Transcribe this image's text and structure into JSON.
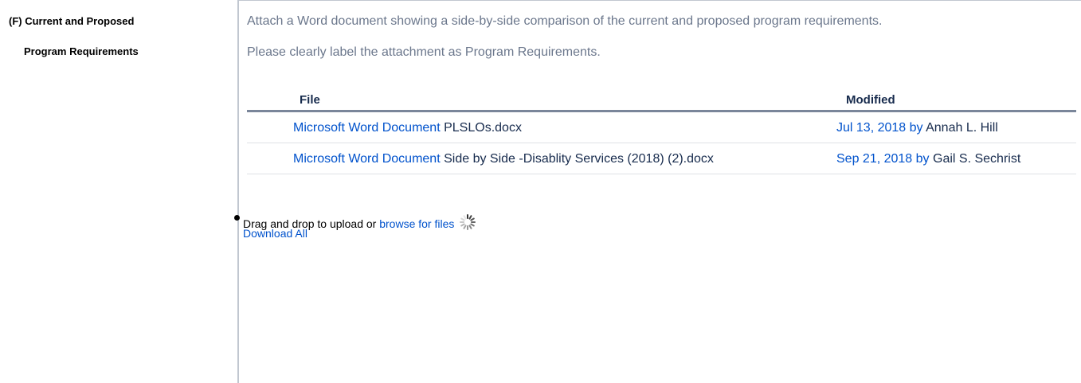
{
  "section": {
    "title_line1": "(F) Current and Proposed",
    "title_line2": "Program Requirements"
  },
  "instructions": {
    "line1": "Attach a Word document showing a side-by-side comparison of the current and proposed program requirements.",
    "line2": "Please clearly label the attachment as Program Requirements."
  },
  "table": {
    "headers": {
      "file": "File",
      "modified": "Modified"
    },
    "rows": [
      {
        "file_type": "Microsoft Word Document",
        "file_name": "PLSLOs.docx",
        "date": "Jul 13, 2018",
        "by": "by",
        "author": "Annah L. Hill"
      },
      {
        "file_type": "Microsoft Word Document",
        "file_name": "Side by Side -Disablity Services (2018) (2).docx",
        "date": "Sep 21, 2018",
        "by": "by",
        "author": "Gail S. Sechrist"
      }
    ]
  },
  "upload": {
    "prompt": "Drag and drop to upload or",
    "browse_label": "browse for files",
    "spinner_icon": "loading-spinner-icon",
    "download_all_label": "Download All"
  },
  "colors": {
    "link": "#0052cc",
    "instruction_text": "#6b778c",
    "border": "#c1c7d0",
    "header_rule": "#7a869a"
  }
}
